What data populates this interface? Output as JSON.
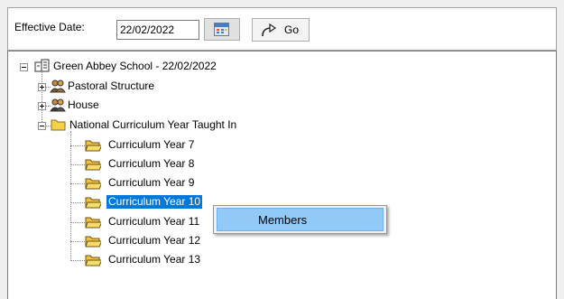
{
  "toolbar": {
    "effective_date_label": "Effective Date:",
    "effective_date_value": "22/02/2022",
    "go_label": "Go"
  },
  "tree": {
    "root": "Green Abbey School - 22/02/2022",
    "nodes": [
      "Pastoral Structure",
      "House",
      "National Curriculum Year Taught In"
    ],
    "curriculum_years": [
      "Curriculum Year  7",
      "Curriculum Year  8",
      "Curriculum Year  9",
      "Curriculum Year 10",
      "Curriculum Year 11",
      "Curriculum Year 12",
      "Curriculum Year 13"
    ],
    "selected": "Curriculum Year 10"
  },
  "context_menu": {
    "items": [
      "Members"
    ]
  },
  "icons": {
    "calendar": "calendar-icon",
    "go": "go-arrow-icon",
    "root": "school-structure-icon",
    "pastoral": "pastoral-group-icon",
    "house": "house-group-icon",
    "folder": "folder-icon"
  },
  "colors": {
    "selection": "#0078d7",
    "menu_highlight": "#91c9f7",
    "folder": "#f5d04a"
  }
}
